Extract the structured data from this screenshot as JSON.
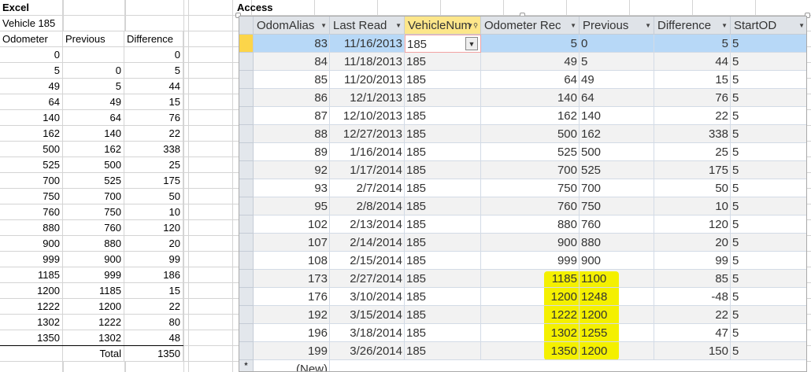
{
  "excel": {
    "title": "Excel",
    "subtitle": "Vehicle 185",
    "headers": [
      "Odometer",
      "Previous",
      "Difference"
    ],
    "rows": [
      [
        "0",
        "",
        "0"
      ],
      [
        "5",
        "0",
        "5"
      ],
      [
        "49",
        "5",
        "44"
      ],
      [
        "64",
        "49",
        "15"
      ],
      [
        "140",
        "64",
        "76"
      ],
      [
        "162",
        "140",
        "22"
      ],
      [
        "500",
        "162",
        "338"
      ],
      [
        "525",
        "500",
        "25"
      ],
      [
        "700",
        "525",
        "175"
      ],
      [
        "750",
        "700",
        "50"
      ],
      [
        "760",
        "750",
        "10"
      ],
      [
        "880",
        "760",
        "120"
      ],
      [
        "900",
        "880",
        "20"
      ],
      [
        "999",
        "900",
        "99"
      ],
      [
        "1185",
        "999",
        "186"
      ],
      [
        "1200",
        "1185",
        "15"
      ],
      [
        "1222",
        "1200",
        "22"
      ],
      [
        "1302",
        "1222",
        "80"
      ],
      [
        "1350",
        "1302",
        "48"
      ]
    ],
    "total_label": "Total",
    "total_value": "1350"
  },
  "access": {
    "title": "Access",
    "columns": [
      "OdomAlias",
      "Last Read",
      "VehicleNum",
      "Odometer Rec",
      "Previous",
      "Difference",
      "StartOD"
    ],
    "rows": [
      [
        "83",
        "11/16/2013",
        "185",
        "5",
        "0",
        "5",
        "5"
      ],
      [
        "84",
        "11/18/2013",
        "185",
        "49",
        "5",
        "44",
        "5"
      ],
      [
        "85",
        "11/20/2013",
        "185",
        "64",
        "49",
        "15",
        "5"
      ],
      [
        "86",
        "12/1/2013",
        "185",
        "140",
        "64",
        "76",
        "5"
      ],
      [
        "87",
        "12/10/2013",
        "185",
        "162",
        "140",
        "22",
        "5"
      ],
      [
        "88",
        "12/27/2013",
        "185",
        "500",
        "162",
        "338",
        "5"
      ],
      [
        "89",
        "1/16/2014",
        "185",
        "525",
        "500",
        "25",
        "5"
      ],
      [
        "92",
        "1/17/2014",
        "185",
        "700",
        "525",
        "175",
        "5"
      ],
      [
        "93",
        "2/7/2014",
        "185",
        "750",
        "700",
        "50",
        "5"
      ],
      [
        "95",
        "2/8/2014",
        "185",
        "760",
        "750",
        "10",
        "5"
      ],
      [
        "102",
        "2/13/2014",
        "185",
        "880",
        "760",
        "120",
        "5"
      ],
      [
        "107",
        "2/14/2014",
        "185",
        "900",
        "880",
        "20",
        "5"
      ],
      [
        "108",
        "2/15/2014",
        "185",
        "999",
        "900",
        "99",
        "5"
      ],
      [
        "173",
        "2/27/2014",
        "185",
        "1185",
        "1100",
        "85",
        "5"
      ],
      [
        "176",
        "3/10/2014",
        "185",
        "1200",
        "1248",
        "-48",
        "5"
      ],
      [
        "192",
        "3/15/2014",
        "185",
        "1222",
        "1200",
        "22",
        "5"
      ],
      [
        "196",
        "3/18/2014",
        "185",
        "1302",
        "1255",
        "47",
        "5"
      ],
      [
        "199",
        "3/26/2014",
        "185",
        "1350",
        "1200",
        "150",
        "5"
      ]
    ],
    "new_row_label": "(New)",
    "highlight_color": "#f4f000",
    "selected_row_color": "#b7d8f7"
  }
}
